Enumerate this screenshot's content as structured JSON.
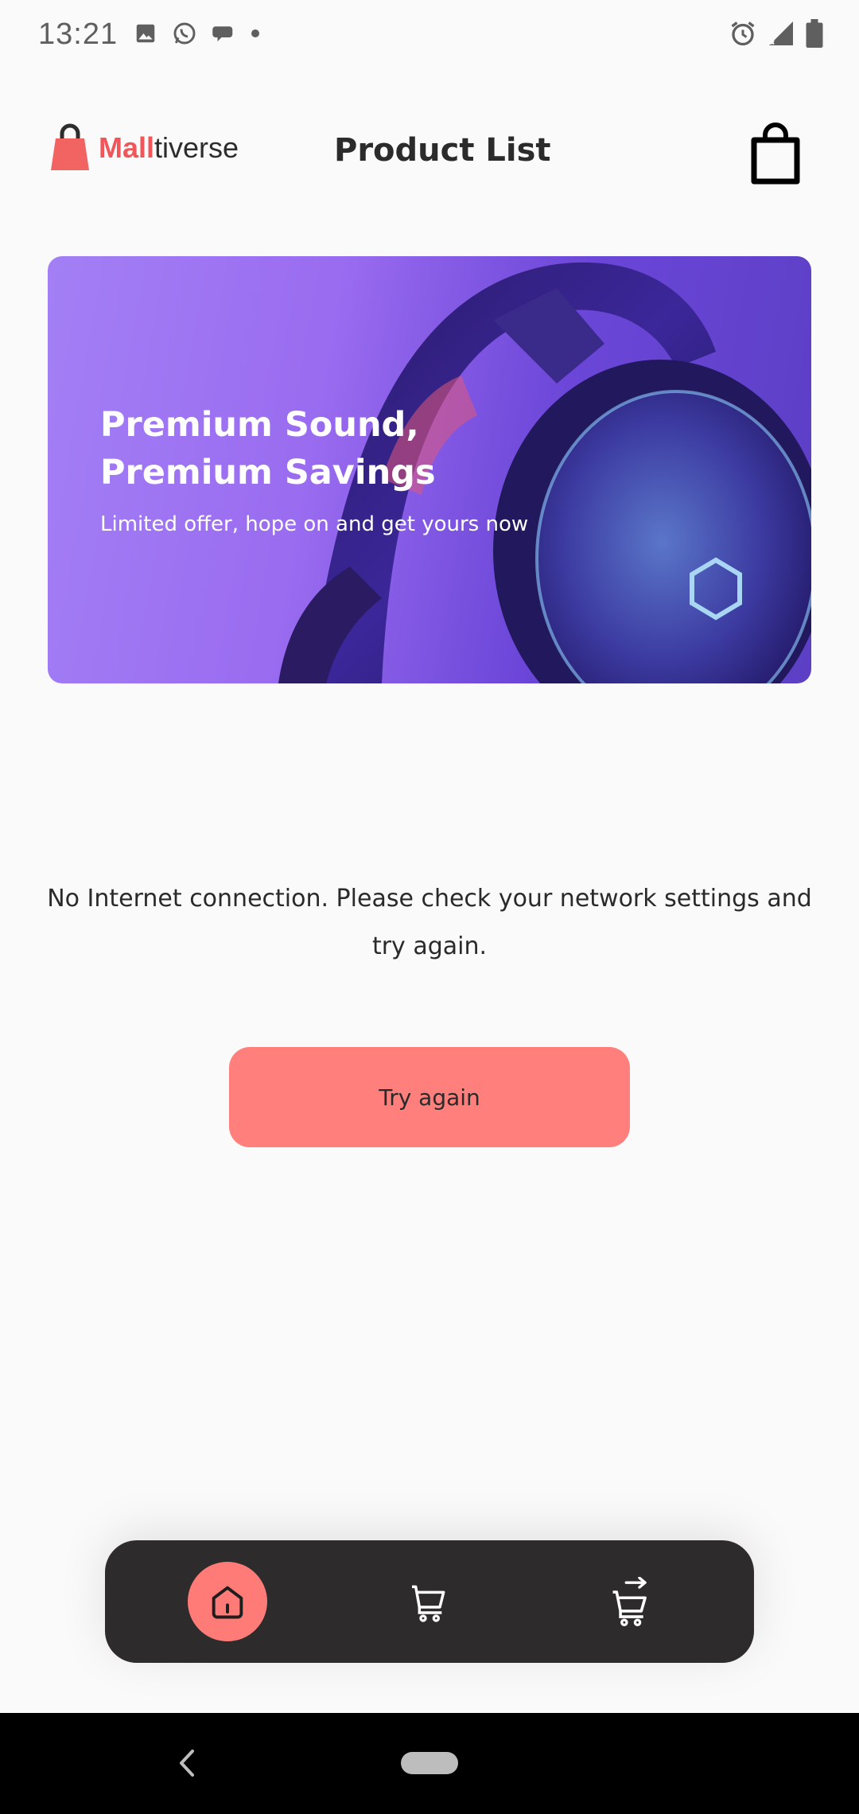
{
  "status_bar": {
    "time": "13:21",
    "left_icons": [
      "image-icon",
      "whatsapp-icon",
      "chat-bubble-icon",
      "dot-icon"
    ],
    "right_icons": [
      "alarm-icon",
      "signal-icon",
      "battery-icon"
    ]
  },
  "header": {
    "logo_accent": "Mall",
    "logo_rest": "tiverse",
    "title": "Product List",
    "bag_icon": "shopping-bag-icon"
  },
  "banner": {
    "heading_line1": "Premium Sound,",
    "heading_line2": "Premium Savings",
    "subtitle": "Limited offer, hope on and get yours now"
  },
  "error": {
    "message": "No Internet connection. Please check your network settings and try again.",
    "retry_label": "Try again"
  },
  "bottom_nav": {
    "items": [
      {
        "name": "home",
        "icon": "home-icon",
        "active": true
      },
      {
        "name": "cart",
        "icon": "cart-icon",
        "active": false
      },
      {
        "name": "checkout",
        "icon": "cart-arrow-icon",
        "active": false
      }
    ]
  },
  "colors": {
    "accent": "#ff7f7c",
    "nav_bg": "#2d2b2b",
    "banner": "#9a6cf0"
  }
}
